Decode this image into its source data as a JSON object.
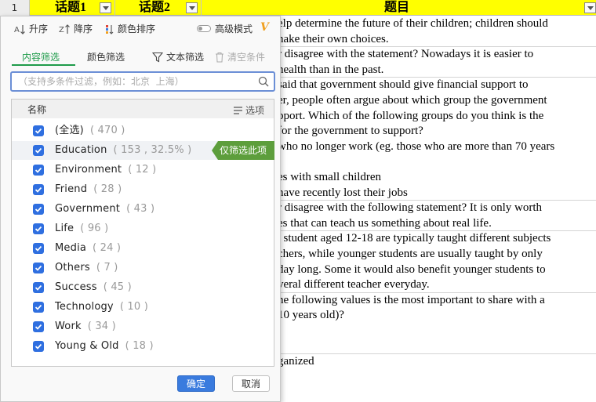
{
  "sheet": {
    "row_number": "1",
    "headers": [
      "话题1",
      "话题2",
      "题目"
    ],
    "lines": [
      "elp determine the future of their children; children should",
      "nake their own choices.",
      "r disagree with the statement? Nowadays it is easier to",
      "health than in the past.",
      " said that government should give financial support to",
      "er, people often argue about which group the government",
      "pport. Which of the following groups do you think is the",
      " for the government to support?",
      "who no longer work (eg. those who are more than 70 years",
      "",
      "es with small children",
      "have recently lost their jobs",
      "r disagree with the following statement? It is only worth",
      "es that can teach us something about real life.",
      ", student aged 12-18 are typically taught different subjects",
      "chers, while younger students are usually taught by only",
      "day long. Some it would also benefit younger students to",
      "veral different teacher everyday.",
      "he following values is the most important to share with a",
      "10 years old)?",
      "",
      "",
      "ganized"
    ]
  },
  "filter": {
    "toolbar": {
      "sort_asc": "升序",
      "sort_desc": "降序",
      "color_sort": "颜色排序",
      "advanced_mode": "高级模式"
    },
    "tabs": {
      "content_filter": "内容筛选",
      "color_filter": "颜色筛选",
      "text_filter": "文本筛选",
      "clear_conditions": "清空条件"
    },
    "search": {
      "placeholder": "（支持多条件过滤，例如：北京  上海）",
      "value": ""
    },
    "list": {
      "header_name": "名称",
      "header_options": "选项",
      "only_this_label": "仅筛选此项",
      "items": [
        {
          "label": "(全选)",
          "count": "( 470 )",
          "checked": true
        },
        {
          "label": "Education",
          "count": "( 153 , 32.5% )",
          "checked": true
        },
        {
          "label": "Environment",
          "count": "( 12 )",
          "checked": true
        },
        {
          "label": "Friend",
          "count": "( 28 )",
          "checked": true
        },
        {
          "label": "Government",
          "count": "( 43 )",
          "checked": true
        },
        {
          "label": "Life",
          "count": "( 96 )",
          "checked": true
        },
        {
          "label": "Media",
          "count": "( 24 )",
          "checked": true
        },
        {
          "label": "Others",
          "count": "( 7 )",
          "checked": true
        },
        {
          "label": "Success",
          "count": "( 45 )",
          "checked": true
        },
        {
          "label": "Technology",
          "count": "( 10 )",
          "checked": true
        },
        {
          "label": "Work",
          "count": "( 34 )",
          "checked": true
        },
        {
          "label": "Young & Old",
          "count": "( 18 )",
          "checked": true
        }
      ]
    },
    "buttons": {
      "ok": "确定",
      "cancel": "取消"
    },
    "colors": {
      "accent_green": "#1e9b4a",
      "checkbox_blue": "#2f6fe0",
      "only_this_green": "#5d9e3c",
      "header_yellow": "#ffff00"
    }
  }
}
